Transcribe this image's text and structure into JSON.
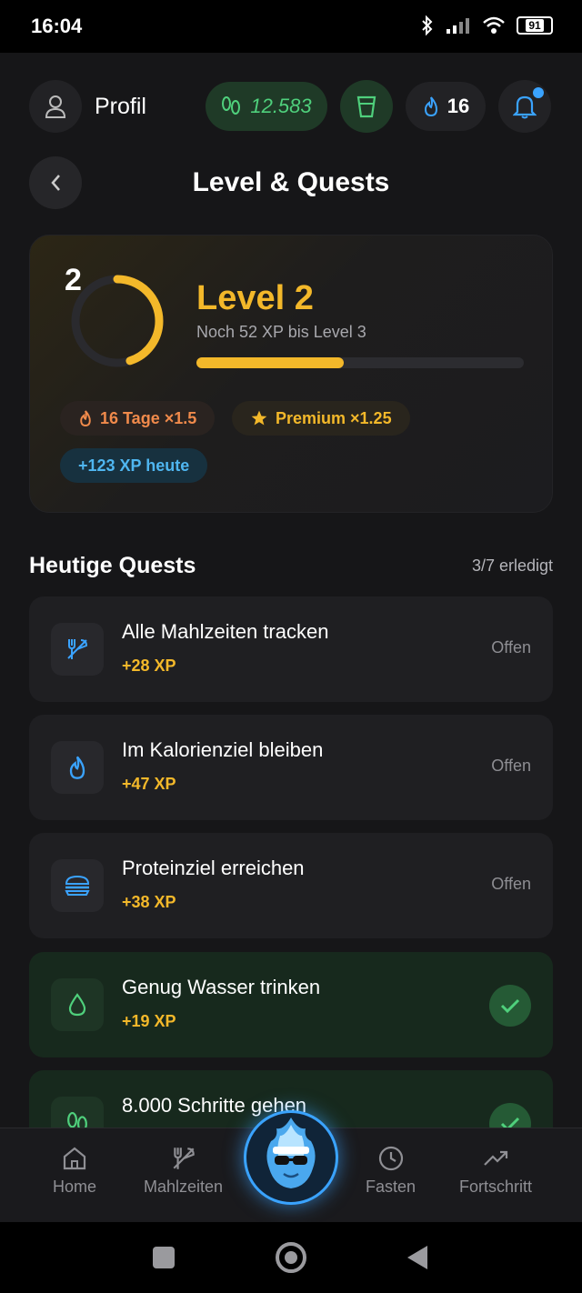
{
  "status_bar": {
    "time": "16:04",
    "battery": "91"
  },
  "header": {
    "profile_label": "Profil",
    "steps": "12.583",
    "streak": "16"
  },
  "page": {
    "title": "Level & Quests"
  },
  "level_card": {
    "ring_number": "2",
    "title": "Level 2",
    "subtitle": "Noch 52 XP bis Level 3",
    "progress": 0.45,
    "badges": {
      "streak": "16 Tage ×1.5",
      "premium": "Premium ×1.25",
      "xp_today": "+123 XP heute"
    }
  },
  "quests": {
    "title": "Heutige Quests",
    "count": "3/7 erledigt",
    "items": [
      {
        "name": "Alle Mahlzeiten tracken",
        "xp": "+28 XP",
        "status": "Offen",
        "icon": "fork-knife-icon"
      },
      {
        "name": "Im Kalorienziel bleiben",
        "xp": "+47 XP",
        "status": "Offen",
        "icon": "flame-icon"
      },
      {
        "name": "Proteinziel erreichen",
        "xp": "+38 XP",
        "status": "Offen",
        "icon": "burger-icon"
      },
      {
        "name": "Genug Wasser trinken",
        "xp": "+19 XP",
        "status": "done",
        "icon": "water-drop-icon"
      },
      {
        "name": "8.000 Schritte gehen",
        "xp": "",
        "status": "done",
        "icon": "footsteps-icon"
      }
    ]
  },
  "bottom_nav": {
    "home": "Home",
    "meals": "Mahlzeiten",
    "fasting": "Fasten",
    "progress": "Fortschritt"
  },
  "colors": {
    "accent_gold": "#f3b82a",
    "accent_blue": "#3aa3ff",
    "accent_green": "#4fd07c"
  }
}
